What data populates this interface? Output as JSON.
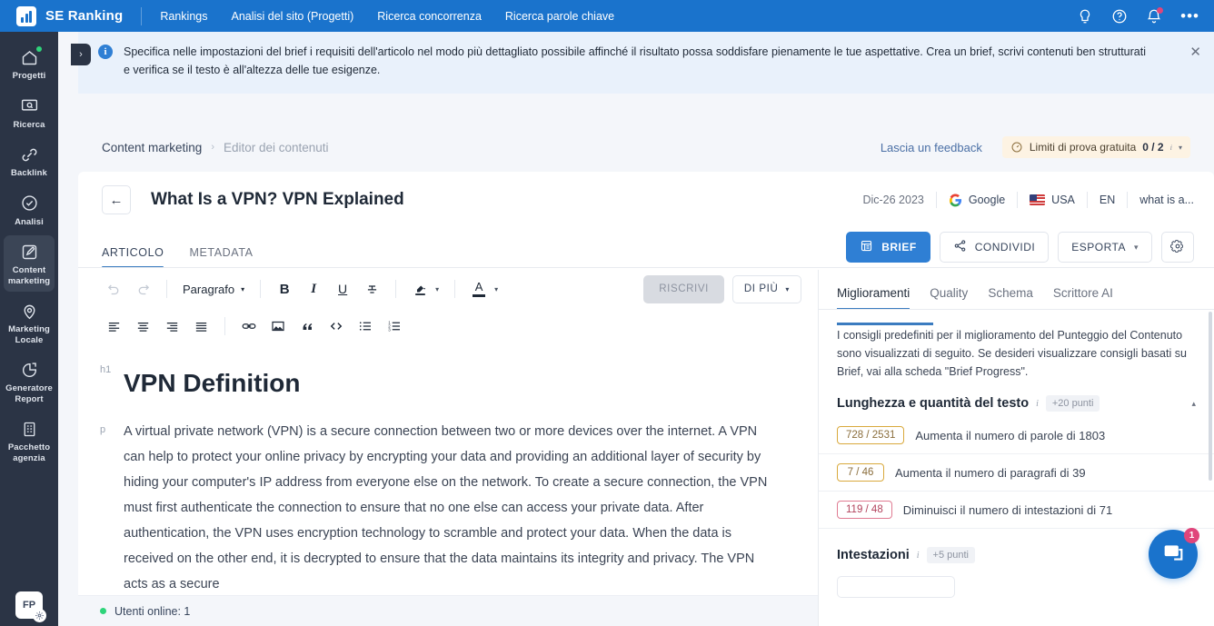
{
  "topbar": {
    "brand": "SE Ranking",
    "nav": [
      {
        "label": "Rankings"
      },
      {
        "label": "Analisi del sito (Progetti)"
      },
      {
        "label": "Ricerca concorrenza"
      },
      {
        "label": "Ricerca parole chiave"
      }
    ],
    "icons": [
      {
        "name": "lightbulb-icon"
      },
      {
        "name": "help-circle-icon"
      },
      {
        "name": "bell-icon"
      },
      {
        "name": "more-horizontal-icon"
      }
    ],
    "more_label": "•••",
    "accent": "#1a73cc"
  },
  "rail": {
    "items": [
      {
        "label": "Progetti",
        "icon": "home-icon",
        "active": false,
        "dot": true
      },
      {
        "label": "Ricerca",
        "icon": "search-monitor-icon",
        "active": false,
        "dot": false
      },
      {
        "label": "Backlink",
        "icon": "link-icon",
        "active": false,
        "dot": false
      },
      {
        "label": "Analisi",
        "icon": "check-circle-icon",
        "active": false,
        "dot": false
      },
      {
        "label": "Content marketing",
        "icon": "pencil-square-icon",
        "active": true,
        "dot": false
      },
      {
        "label": "Marketing Locale",
        "icon": "map-pin-icon",
        "active": false,
        "dot": false
      },
      {
        "label": "Generatore Report",
        "icon": "pie-chart-icon",
        "active": false,
        "dot": false
      },
      {
        "label": "Pacchetto agenzia",
        "icon": "building-icon",
        "active": false,
        "dot": false
      }
    ],
    "avatar_initials": "FP",
    "collapse_icon": "chevron-right-icon"
  },
  "banner": {
    "icon": "info-icon",
    "text": "Specifica nelle impostazioni del brief i requisiti dell'articolo nel modo più dettagliato possibile affinché il risultato possa soddisfare pienamente le tue aspettative. Crea un brief, scrivi contenuti ben strutturati e verifica se il testo è all'altezza delle tue esigenze.",
    "close_label": "✕",
    "background": "#e9f1fb"
  },
  "breadcrumb": {
    "root": "Content marketing",
    "separator": "›",
    "current": "Editor dei contenuti",
    "feedback_label": "Lascia un feedback",
    "trial": {
      "label": "Limiti di prova gratuita",
      "value": "0 / 2",
      "info": "i",
      "caret": "▾",
      "icon": "gauge-icon",
      "background": "#fdf3e3"
    }
  },
  "document_header": {
    "back_icon": "arrow-left-icon",
    "title": "What Is a VPN? VPN Explained",
    "meta": {
      "date": "Dic-26 2023",
      "engine": "Google",
      "engine_icon": "google-icon",
      "country": "USA",
      "country_icon": "us-flag-icon",
      "language": "EN",
      "keyword": "what is a..."
    }
  },
  "doc_tabs": [
    {
      "label": "ARTICOLO",
      "active": true
    },
    {
      "label": "METADATA",
      "active": false
    }
  ],
  "actions": {
    "brief": {
      "label": "BRIEF",
      "icon": "list-panel-icon"
    },
    "share": {
      "label": "CONDIVIDI",
      "icon": "share-icon"
    },
    "export": {
      "label": "ESPORTA",
      "caret": "▾"
    },
    "settings": {
      "icon": "gear-icon"
    }
  },
  "toolbar": {
    "undo_icon": "undo-icon",
    "redo_icon": "redo-icon",
    "paragraph_label": "Paragrafo",
    "paragraph_caret": "▾",
    "bold_label": "B",
    "italic_label": "I",
    "underline_label": "U",
    "strikethrough_icon": "strikethrough-icon",
    "highlight_icon": "highlight-color-icon",
    "highlight_caret": "▾",
    "font_color_label": "A",
    "font_color_caret": "▾",
    "rewrite_label": "RISCRIVI",
    "more_label": "DI PIÙ",
    "more_caret": "▾",
    "row2": [
      {
        "icon": "align-left-icon"
      },
      {
        "icon": "align-center-icon"
      },
      {
        "icon": "align-right-icon"
      },
      {
        "icon": "align-justify-icon"
      },
      {
        "icon": "link-insert-icon"
      },
      {
        "icon": "image-icon"
      },
      {
        "icon": "quote-icon"
      },
      {
        "icon": "code-icon"
      },
      {
        "icon": "bullet-list-icon"
      },
      {
        "icon": "numbered-list-icon"
      }
    ]
  },
  "document": {
    "blocks": [
      {
        "tag": "h1",
        "text": "VPN Definition"
      },
      {
        "tag": "p",
        "text": "A virtual private network (VPN) is a secure connection between two or more devices over the internet. A VPN can help to protect your online privacy by encrypting your data and providing an additional layer of security by hiding your computer's IP address from everyone else on the network. To create a secure connection, the VPN must first authenticate the connection to ensure that no one else can access your private data. After authentication, the VPN uses encryption technology to scramble and protect your data. When the data is received on the other end, it is decrypted to ensure that the data maintains its integrity and privacy. The VPN acts as a secure"
      }
    ],
    "status": {
      "online_label": "Utenti online: 1",
      "dot_color": "#2ed47a"
    }
  },
  "panel": {
    "tabs": [
      {
        "label": "Miglioramenti",
        "active": true
      },
      {
        "label": "Quality",
        "active": false
      },
      {
        "label": "Schema",
        "active": false
      },
      {
        "label": "Scrittore AI",
        "active": false
      }
    ],
    "note": "I consigli predefiniti per il miglioramento del Punteggio del Contenuto sono visualizzati di seguito. Se desideri visualizzare consigli basati su Brief, vai alla scheda \"Brief Progress\".",
    "sections": [
      {
        "title": "Lunghezza e quantità del testo",
        "info": "i",
        "points": "+20 punti",
        "caret": "▴",
        "recommendations": [
          {
            "badge": "728 / 2531",
            "text": "Aumenta il numero di parole di 1803",
            "state": "warn"
          },
          {
            "badge": "7 / 46",
            "text": "Aumenta il numero di paragrafi di 39",
            "state": "warn"
          },
          {
            "badge": "119 / 48",
            "text": "Diminuisci il numero di intestazioni di 71",
            "state": "over"
          }
        ]
      },
      {
        "title": "Intestazioni",
        "info": "i",
        "points": "+5 punti",
        "caret": "▴",
        "recommendations": []
      }
    ]
  },
  "chat": {
    "icon": "chat-icon",
    "badge": "1",
    "color": "#1a73cc"
  }
}
